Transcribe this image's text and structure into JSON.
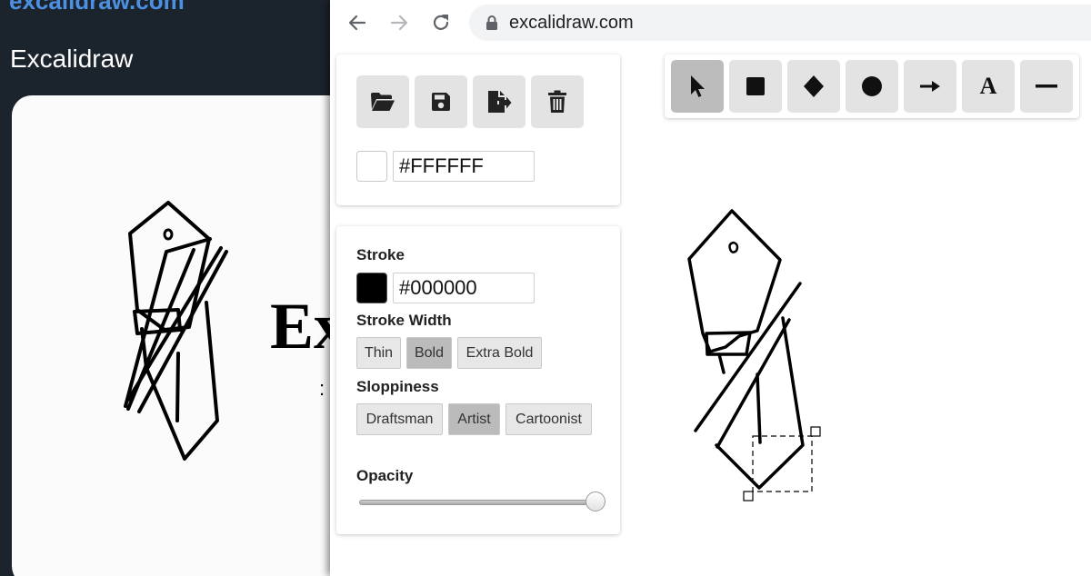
{
  "background_page": {
    "url_partial": "excalidraw.com",
    "title": "Excalidraw",
    "card_text_visible": "Ex"
  },
  "browser": {
    "url": "excalidraw.com",
    "nav_icons": [
      "back-arrow-icon",
      "forward-arrow-icon",
      "reload-icon",
      "lock-icon"
    ]
  },
  "file_panel": {
    "buttons": [
      {
        "name": "open-button",
        "icon": "folder-open-icon"
      },
      {
        "name": "save-button",
        "icon": "floppy-disk-icon"
      },
      {
        "name": "export-button",
        "icon": "file-export-icon"
      },
      {
        "name": "delete-button",
        "icon": "trash-icon"
      }
    ],
    "background_color": "#FFFFFF"
  },
  "properties_panel": {
    "stroke_label": "Stroke",
    "stroke_color": "#000000",
    "stroke_width_label": "Stroke Width",
    "stroke_width_options": [
      "Thin",
      "Bold",
      "Extra Bold"
    ],
    "stroke_width_selected": "Bold",
    "sloppiness_label": "Sloppiness",
    "sloppiness_options": [
      "Draftsman",
      "Artist",
      "Cartoonist"
    ],
    "sloppiness_selected": "Artist",
    "opacity_label": "Opacity",
    "opacity_value": 1.0
  },
  "toolbar": {
    "tools": [
      {
        "name": "tool-selection",
        "icon": "cursor-icon",
        "active": true
      },
      {
        "name": "tool-rectangle",
        "icon": "square-icon"
      },
      {
        "name": "tool-diamond",
        "icon": "diamond-icon"
      },
      {
        "name": "tool-ellipse",
        "icon": "circle-icon"
      },
      {
        "name": "tool-arrow",
        "icon": "arrow-icon"
      },
      {
        "name": "tool-text",
        "icon": "text-icon",
        "glyph": "A"
      },
      {
        "name": "tool-line",
        "icon": "line-icon"
      }
    ]
  },
  "colors": {
    "page_dark": "#1b232c",
    "link_blue": "#4d8fe0",
    "button_gray": "#e3e3e3",
    "button_active": "#bcbcbc"
  }
}
